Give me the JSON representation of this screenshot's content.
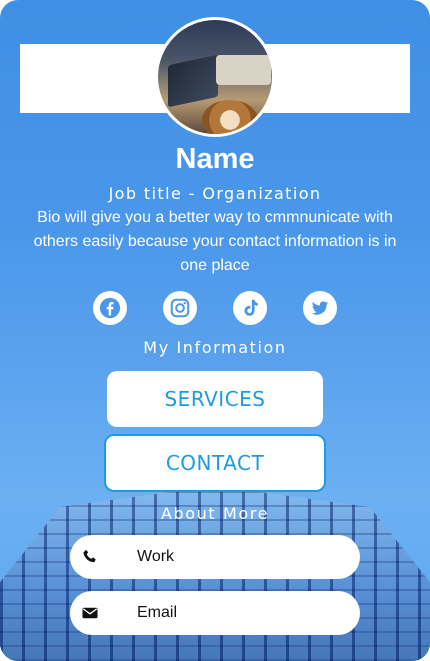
{
  "profile": {
    "name": "Name",
    "job_title": "Job title - Organization",
    "bio": "Bio will give you a better way to cmmnunicate with others easily because your contact information is in one place"
  },
  "socials": [
    {
      "icon": "facebook-icon"
    },
    {
      "icon": "instagram-icon"
    },
    {
      "icon": "tiktok-icon"
    },
    {
      "icon": "twitter-icon"
    }
  ],
  "sections": {
    "my_information": "My Information",
    "about_more": "About More"
  },
  "buttons": {
    "services": "SERVICES",
    "contact": "CONTACT"
  },
  "contacts": [
    {
      "label": "Work",
      "icon": "phone-icon"
    },
    {
      "label": "Email",
      "icon": "envelope-icon"
    }
  ],
  "colors": {
    "accent": "#1e9be0",
    "background": "#4a97ea",
    "text_on_bg": "#ffffff"
  }
}
